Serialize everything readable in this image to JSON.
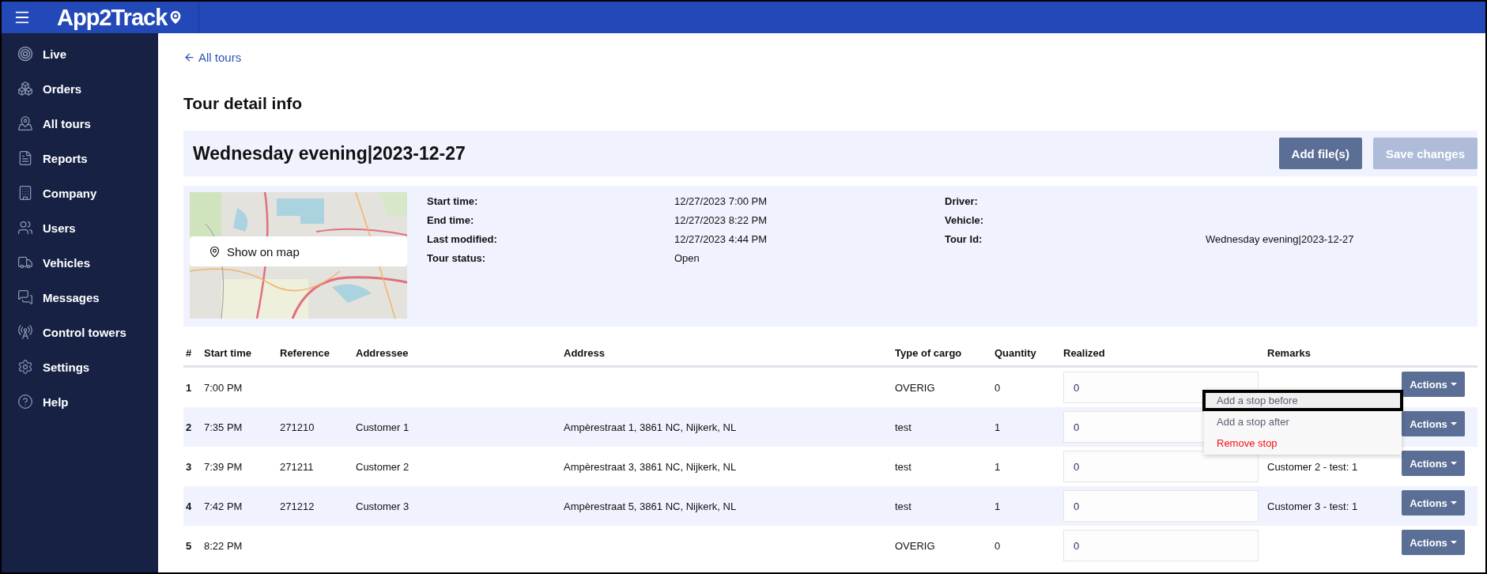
{
  "header": {
    "logo": "App2Track"
  },
  "sidebar": {
    "items": [
      {
        "label": "Live",
        "selected": false
      },
      {
        "label": "Orders",
        "selected": false
      },
      {
        "label": "All tours",
        "selected": false
      },
      {
        "label": "Reports",
        "selected": false
      },
      {
        "label": "Company",
        "selected": false
      },
      {
        "label": "Users",
        "selected": false
      },
      {
        "label": "Vehicles",
        "selected": false
      },
      {
        "label": "Messages",
        "selected": false
      },
      {
        "label": "Control towers",
        "selected": false
      },
      {
        "label": "Settings",
        "selected": false
      },
      {
        "label": "Help",
        "selected": false
      }
    ]
  },
  "back_link": "All tours",
  "page_title": "Tour detail info",
  "tour": {
    "name": "Wednesday evening|2023-12-27",
    "buttons": [
      {
        "label": "Add file(s)",
        "disabled": false
      },
      {
        "label": "Save changes",
        "disabled": true
      }
    ],
    "map_button": "Show on map",
    "details": [
      {
        "label": "Start time:",
        "value": "12/27/2023 7:00 PM"
      },
      {
        "label": "Driver:"
      },
      {
        "label": "End time:",
        "value": "12/27/2023 8:22 PM"
      },
      {
        "label": "Vehicle:"
      },
      {
        "label": "Last modified:",
        "value": "12/27/2023 4:44 PM"
      },
      {
        "label": "Tour Id:",
        "value": "Wednesday evening|2023-12-27"
      },
      {
        "label": "Tour status:",
        "value": "Open"
      }
    ]
  },
  "table": {
    "columns": [
      "#",
      "Start time",
      "Reference",
      "Addressee",
      "Address",
      "Type of cargo",
      "Quantity",
      "Realized",
      "Remarks"
    ],
    "rows": [
      {
        "cells": [
          "1",
          "7:00 PM",
          null,
          null,
          null,
          "OVERIG",
          "0"
        ],
        "realized": "0",
        "action": "Actions"
      },
      {
        "cells": [
          "2",
          "7:35 PM",
          "271210",
          "Customer 1",
          "Ampèrestraat 1, 3861 NC, Nijkerk, NL",
          "test",
          "1"
        ],
        "realized": "0",
        "action": "Actions"
      },
      {
        "cells": [
          "3",
          "7:39 PM",
          "271211",
          "Customer 2",
          "Ampèrestraat 3, 3861 NC, Nijkerk, NL",
          "test",
          "1"
        ],
        "realized": "0",
        "remarks": "Customer 2 - test: 1",
        "action": "Actions"
      },
      {
        "cells": [
          "4",
          "7:42 PM",
          "271212",
          "Customer 3",
          "Ampèrestraat 5, 3861 NC, Nijkerk, NL",
          "test",
          "1"
        ],
        "realized": "0",
        "remarks": "Customer 3 - test: 1",
        "action": "Actions"
      },
      {
        "cells": [
          "5",
          "8:22 PM",
          null,
          null,
          null,
          "OVERIG",
          "0"
        ],
        "realized": "0",
        "action": "Actions"
      }
    ]
  },
  "row_menu": {
    "items": [
      {
        "label": "Add a stop before",
        "kind": "normal",
        "selected": true
      },
      {
        "label": "Add a stop after",
        "kind": "normal",
        "selected": false
      },
      {
        "label": "Remove stop",
        "kind": "danger",
        "selected": false
      }
    ]
  }
}
